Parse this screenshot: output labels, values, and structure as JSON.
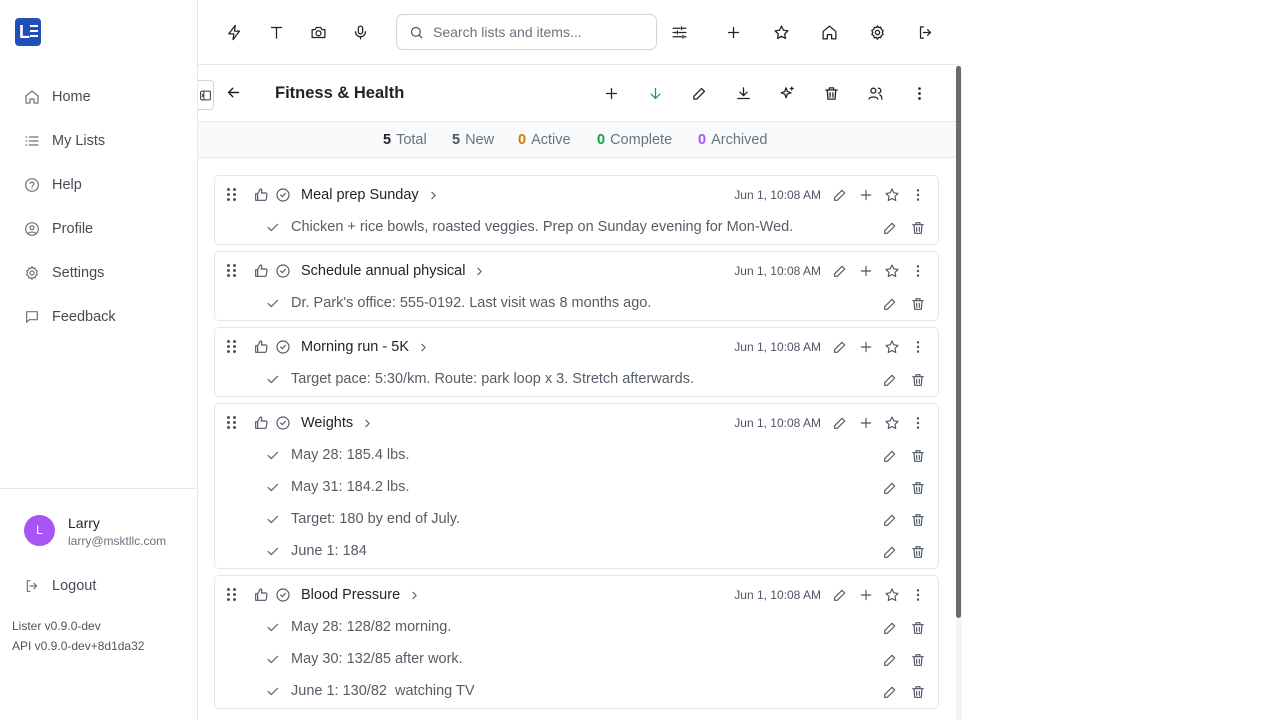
{
  "sidebar": {
    "logo_letter": "L",
    "items": [
      {
        "label": "Home",
        "icon": "home-icon"
      },
      {
        "label": "My Lists",
        "icon": "list-icon"
      },
      {
        "label": "Help",
        "icon": "help-icon"
      },
      {
        "label": "Profile",
        "icon": "user-circle-icon"
      },
      {
        "label": "Settings",
        "icon": "gear-icon"
      },
      {
        "label": "Feedback",
        "icon": "message-icon"
      }
    ],
    "user": {
      "initial": "L",
      "name": "Larry",
      "email": "larry@msktllc.com"
    },
    "logout_label": "Logout",
    "version": "Lister v0.9.0-dev",
    "api_version": "API v0.9.0-dev+8d1da32"
  },
  "toolbar": {
    "search_placeholder": "Search lists and items...",
    "icons": [
      "bolt-icon",
      "text-icon",
      "camera-icon",
      "microphone-icon",
      "filter-sliders-icon",
      "plus-icon",
      "star-icon",
      "home-icon",
      "gear-icon",
      "logout-icon"
    ]
  },
  "list": {
    "title": "Fitness & Health",
    "header_icons": [
      "plus-icon",
      "arrow-down-icon",
      "pencil-icon",
      "download-icon",
      "sparkles-icon",
      "trash-icon",
      "users-icon",
      "more-vertical-icon"
    ],
    "accent_green": "#16a34a"
  },
  "stats": [
    {
      "count": "5",
      "label": "Total",
      "color": "#1f2328"
    },
    {
      "count": "5",
      "label": "New",
      "color": "#4b5563"
    },
    {
      "count": "0",
      "label": "Active",
      "color": "#d97706"
    },
    {
      "count": "0",
      "label": "Complete",
      "color": "#16a34a"
    },
    {
      "count": "0",
      "label": "Archived",
      "color": "#a855f7"
    }
  ],
  "items": [
    {
      "title": "Meal prep Sunday",
      "date": "Jun 1, 10:08 AM",
      "subitems": [
        "Chicken + rice bowls, roasted veggies. Prep on Sunday evening for Mon-Wed."
      ]
    },
    {
      "title": "Schedule annual physical",
      "date": "Jun 1, 10:08 AM",
      "subitems": [
        "Dr. Park's office: 555-0192. Last visit was 8 months ago."
      ]
    },
    {
      "title": "Morning run - 5K",
      "date": "Jun 1, 10:08 AM",
      "subitems": [
        "Target pace: 5:30/km. Route: park loop x 3. Stretch afterwards."
      ]
    },
    {
      "title": "Weights",
      "date": "Jun 1, 10:08 AM",
      "subitems": [
        "May 28: 185.4 lbs.",
        "May 31: 184.2 lbs.",
        "Target: 180 by end of July.",
        "June 1: 184"
      ]
    },
    {
      "title": "Blood Pressure",
      "date": "Jun 1, 10:08 AM",
      "subitems": [
        "May 28: 128/82 morning.",
        "May 30: 132/85 after work.",
        "June 1: 130/82  watching TV"
      ]
    }
  ]
}
